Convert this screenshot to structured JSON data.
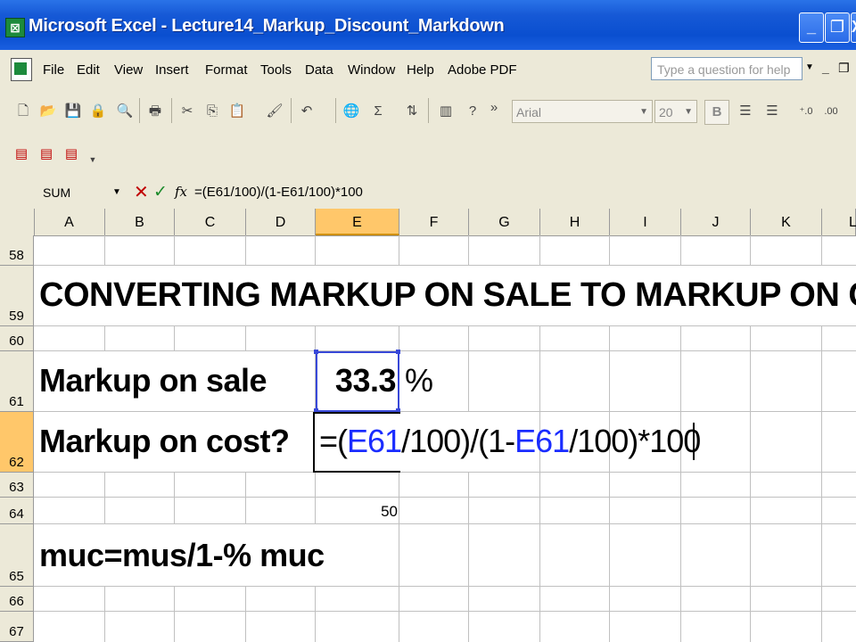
{
  "window": {
    "title": "Microsoft Excel - Lecture14_Markup_Discount_Markdown",
    "app_icon": "excel-icon",
    "buttons": [
      "_",
      "❐",
      "X"
    ]
  },
  "menu": {
    "items": [
      "File",
      "Edit",
      "View",
      "Insert",
      "Format",
      "Tools",
      "Data",
      "Window",
      "Help",
      "Adobe PDF"
    ],
    "help_placeholder": "Type a question for help",
    "mdi_minimize": "_",
    "mdi_restore": "❐"
  },
  "toolbar": {
    "font_name": "Arial",
    "font_size": "20",
    "bold_label": "B",
    "icons": [
      "new-icon",
      "open-icon",
      "save-icon",
      "permission-icon",
      "print-preview-icon",
      "print-icon",
      "cut-icon",
      "copy-icon",
      "paste-icon",
      "format-painter-icon",
      "undo-icon",
      "insert-hyperlink-icon",
      "autosum-icon",
      "sort-ascending-icon",
      "chart-wizard-icon",
      "help-icon",
      "more-icon",
      "align-left-icon",
      "align-center-icon",
      "increase-decimal-icon",
      "decrease-decimal-icon"
    ],
    "pdf_icons": [
      "convert-to-pdf-icon",
      "convert-and-email-icon",
      "convert-and-review-icon"
    ]
  },
  "formula_bar": {
    "name_box": "SUM",
    "cancel_symbol": "✕",
    "enter_symbol": "✓",
    "fx_label": "fx",
    "formula": "=(E61/100)/(1-E61/100)*100"
  },
  "sheet": {
    "columns": [
      "A",
      "B",
      "C",
      "D",
      "E",
      "F",
      "G",
      "H",
      "I",
      "J",
      "K",
      "L"
    ],
    "active_column": "E",
    "rows": [
      "58",
      "59",
      "60",
      "61",
      "62",
      "63",
      "64",
      "65",
      "66",
      "67"
    ],
    "active_row": "62",
    "a59": "CONVERTING MARKUP ON SALE TO MARKUP ON COST",
    "a61": "Markup on sale",
    "e61": "33.3",
    "f61": "%",
    "a62": "Markup on cost?",
    "e62_parts": [
      "=(",
      "E61",
      "/100)/(1-",
      "E61",
      "/100)*100"
    ],
    "e64": "50",
    "a65": "muc=mus/1-% muc"
  },
  "colors": {
    "titlebar": "#0a4fd0",
    "chrome": "#ece9d8",
    "active_header": "#ffc76a",
    "reference_blue": "#1a2cff"
  }
}
